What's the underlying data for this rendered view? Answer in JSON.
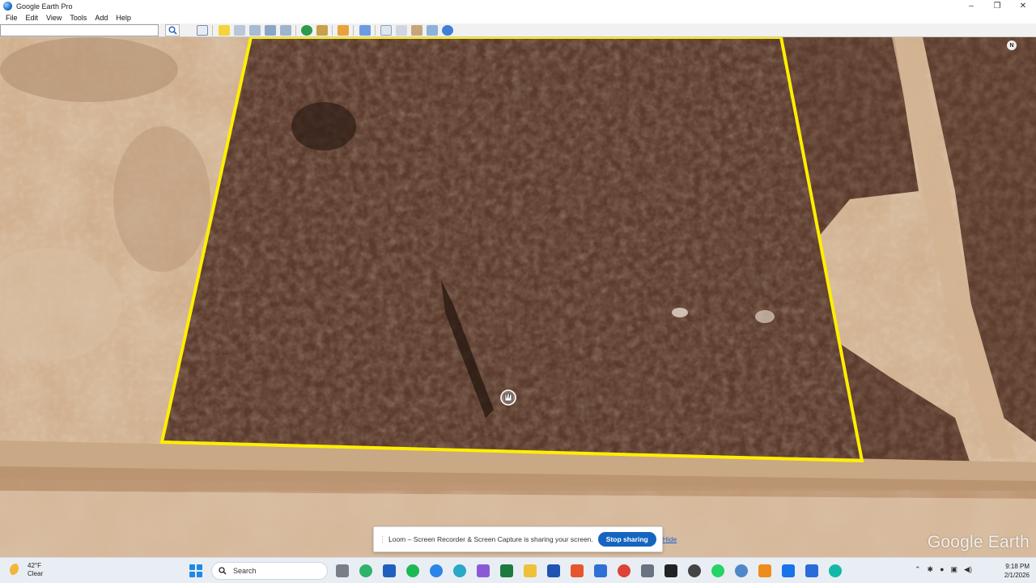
{
  "window": {
    "title": "Google Earth Pro",
    "controls": [
      "–",
      "❐",
      "✕"
    ]
  },
  "menu": [
    "File",
    "Edit",
    "View",
    "Tools",
    "Add",
    "Help"
  ],
  "toolbar": {
    "search_placeholder": ""
  },
  "map": {
    "brand": "Google Earth",
    "compass": "N",
    "polygon_color": "#ffee00"
  },
  "loom": {
    "message": "Loom – Screen Recorder & Screen Capture is sharing your screen.",
    "stop_label": "Stop sharing",
    "hide_label": "Hide"
  },
  "taskbar": {
    "weather_temp": "42°F",
    "weather_desc": "Clear",
    "search_label": "Search",
    "time": "9:18 PM",
    "date": "2/1/2026"
  }
}
